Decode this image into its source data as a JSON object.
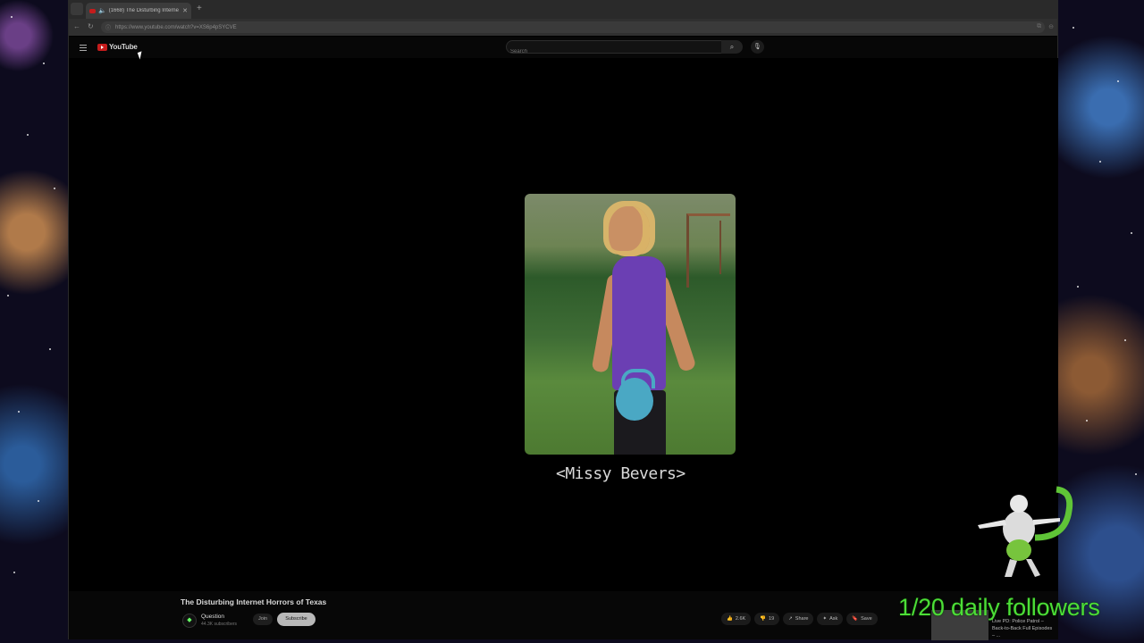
{
  "browser": {
    "tab_title": "(1668) The Disturbing Interne",
    "url": "https://www.youtube.com/watch?v=XS6p4pSYCVE",
    "new_tab_symbol": "+"
  },
  "youtube": {
    "logo_text": "YouTube",
    "search_placeholder": "Search"
  },
  "video": {
    "caption": "<Missy Bevers>"
  },
  "info": {
    "title": "The Disturbing Internet Horrors of Texas",
    "channel_name": "Question",
    "channel_subs": "44.3K subscribers",
    "join_label": "Join",
    "subscribe_label": "Subscribe",
    "likes": "2.6K",
    "dislikes": "19",
    "share_label": "Share",
    "ask_label": "Ask",
    "save_label": "Save"
  },
  "sidebar_video": {
    "title": "Live PD: Police Patrol – Back-to-Back Full Episodes – ..."
  },
  "stream_overlay": {
    "followers_text": "1/20 daily followers",
    "color": "#4cde37"
  }
}
